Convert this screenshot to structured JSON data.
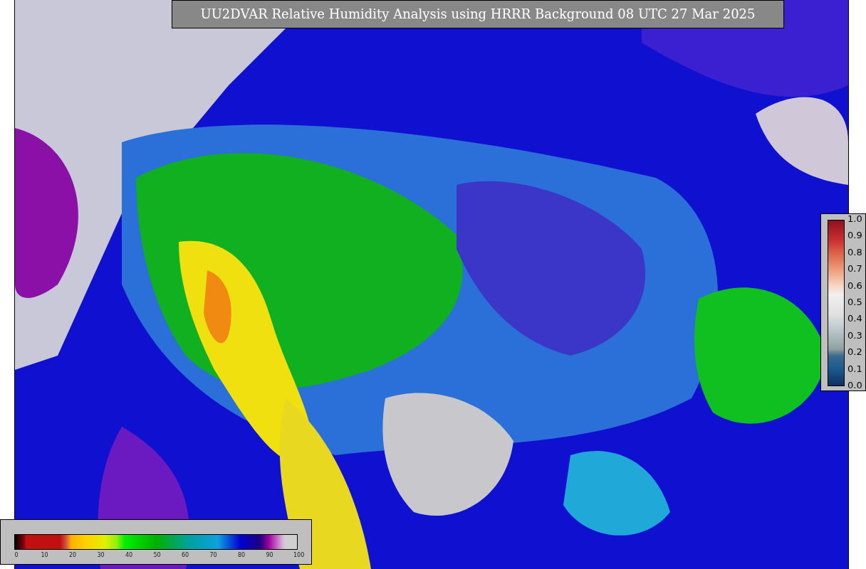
{
  "title": "UU2DVAR Relative Humidity Analysis using HRRR Background 08 UTC 27 Mar 2025",
  "humidity_colorbar": {
    "ticks": [
      "0",
      "10",
      "20",
      "30",
      "40",
      "50",
      "60",
      "70",
      "80",
      "90",
      "100"
    ]
  },
  "station_colorbar": {
    "ticks": [
      "1.0",
      "0.9",
      "0.8",
      "0.7",
      "0.6",
      "0.5",
      "0.4",
      "0.3",
      "0.2",
      "0.1",
      "0.0"
    ]
  }
}
